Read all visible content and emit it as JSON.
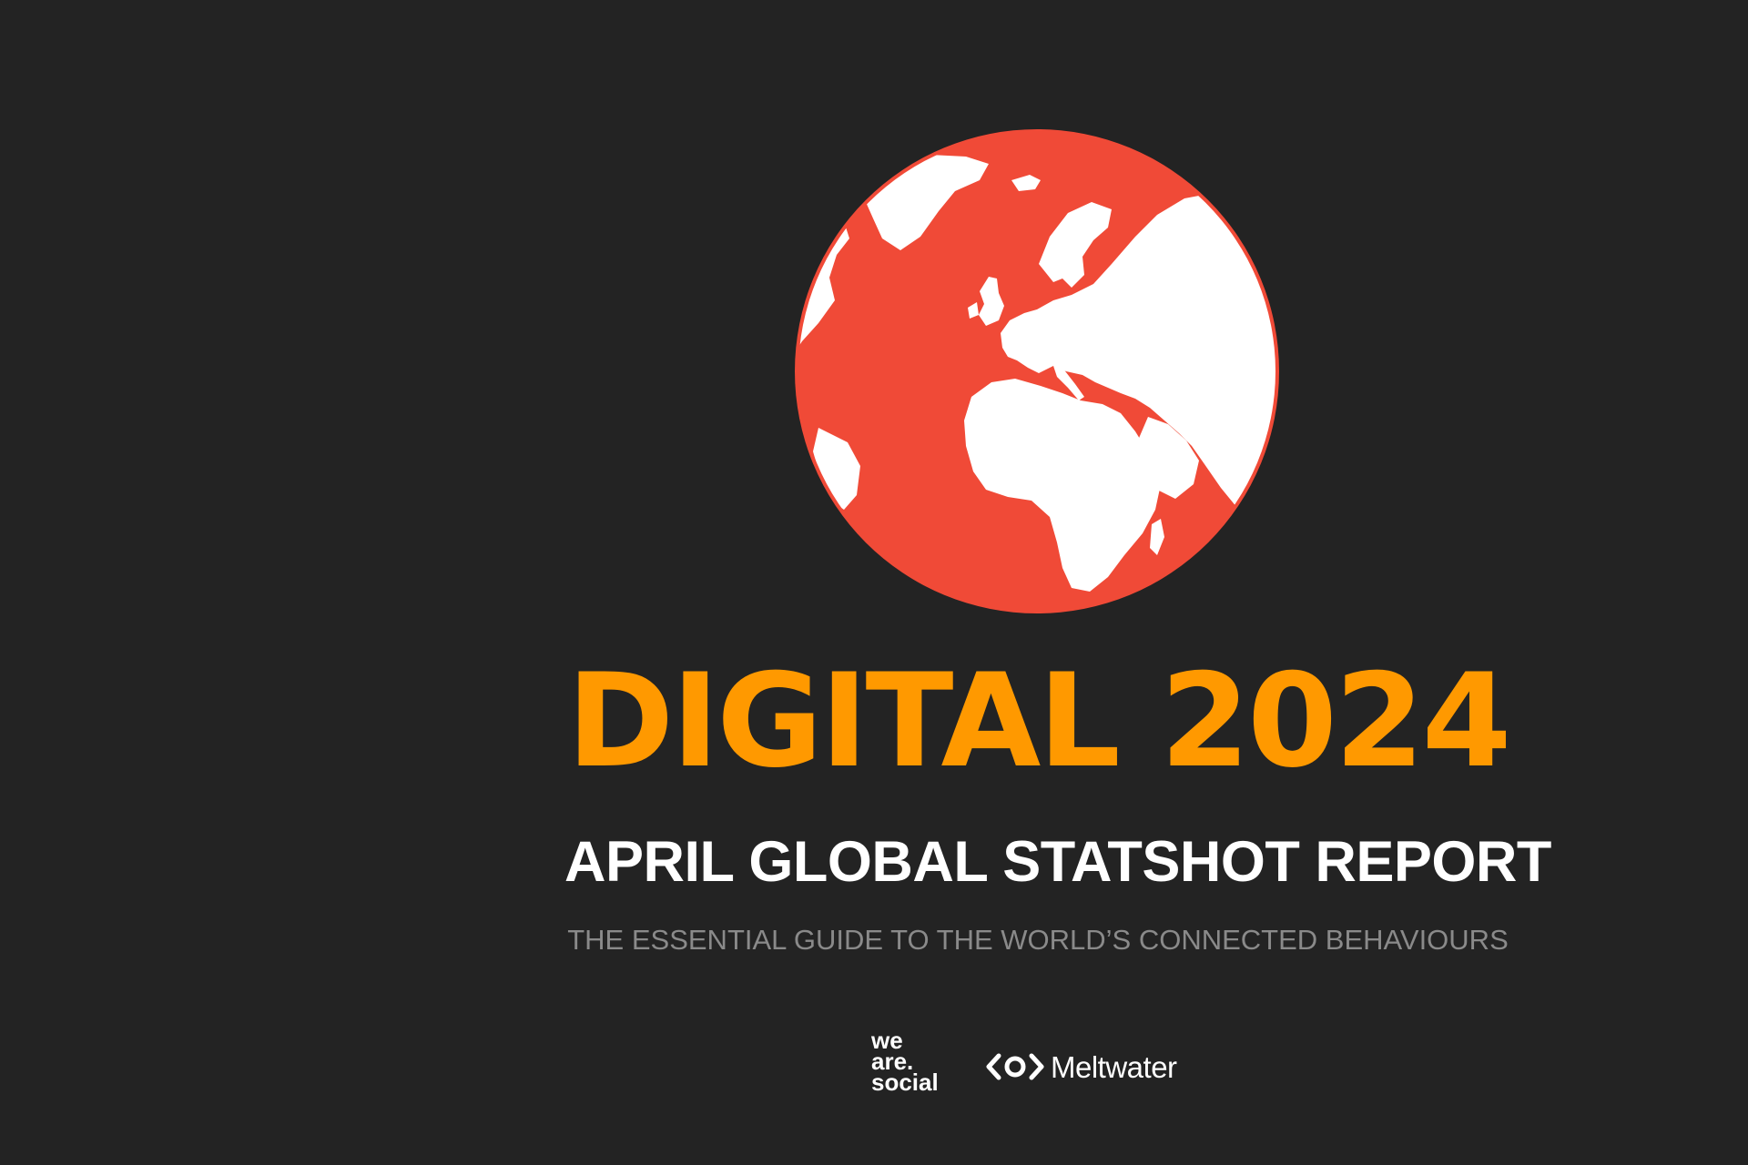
{
  "cover": {
    "title": "DIGITAL 2024",
    "subtitle": "APRIL GLOBAL STATSHOT REPORT",
    "tagline": "THE ESSENTIAL GUIDE TO THE WORLD’S CONNECTED BEHAVIOURS"
  },
  "brands": {
    "we_are_social": [
      "we",
      "are.",
      "social"
    ],
    "meltwater": "Meltwater"
  },
  "icons": {
    "globe": "globe-icon",
    "meltwater_logo": "meltwater-logo-icon"
  },
  "colors": {
    "background": "#232323",
    "globe_ocean": "#f04a37",
    "land": "#ffffff",
    "title": "#ff9900",
    "subtitle": "#ffffff",
    "tagline": "#8a8a8a"
  }
}
